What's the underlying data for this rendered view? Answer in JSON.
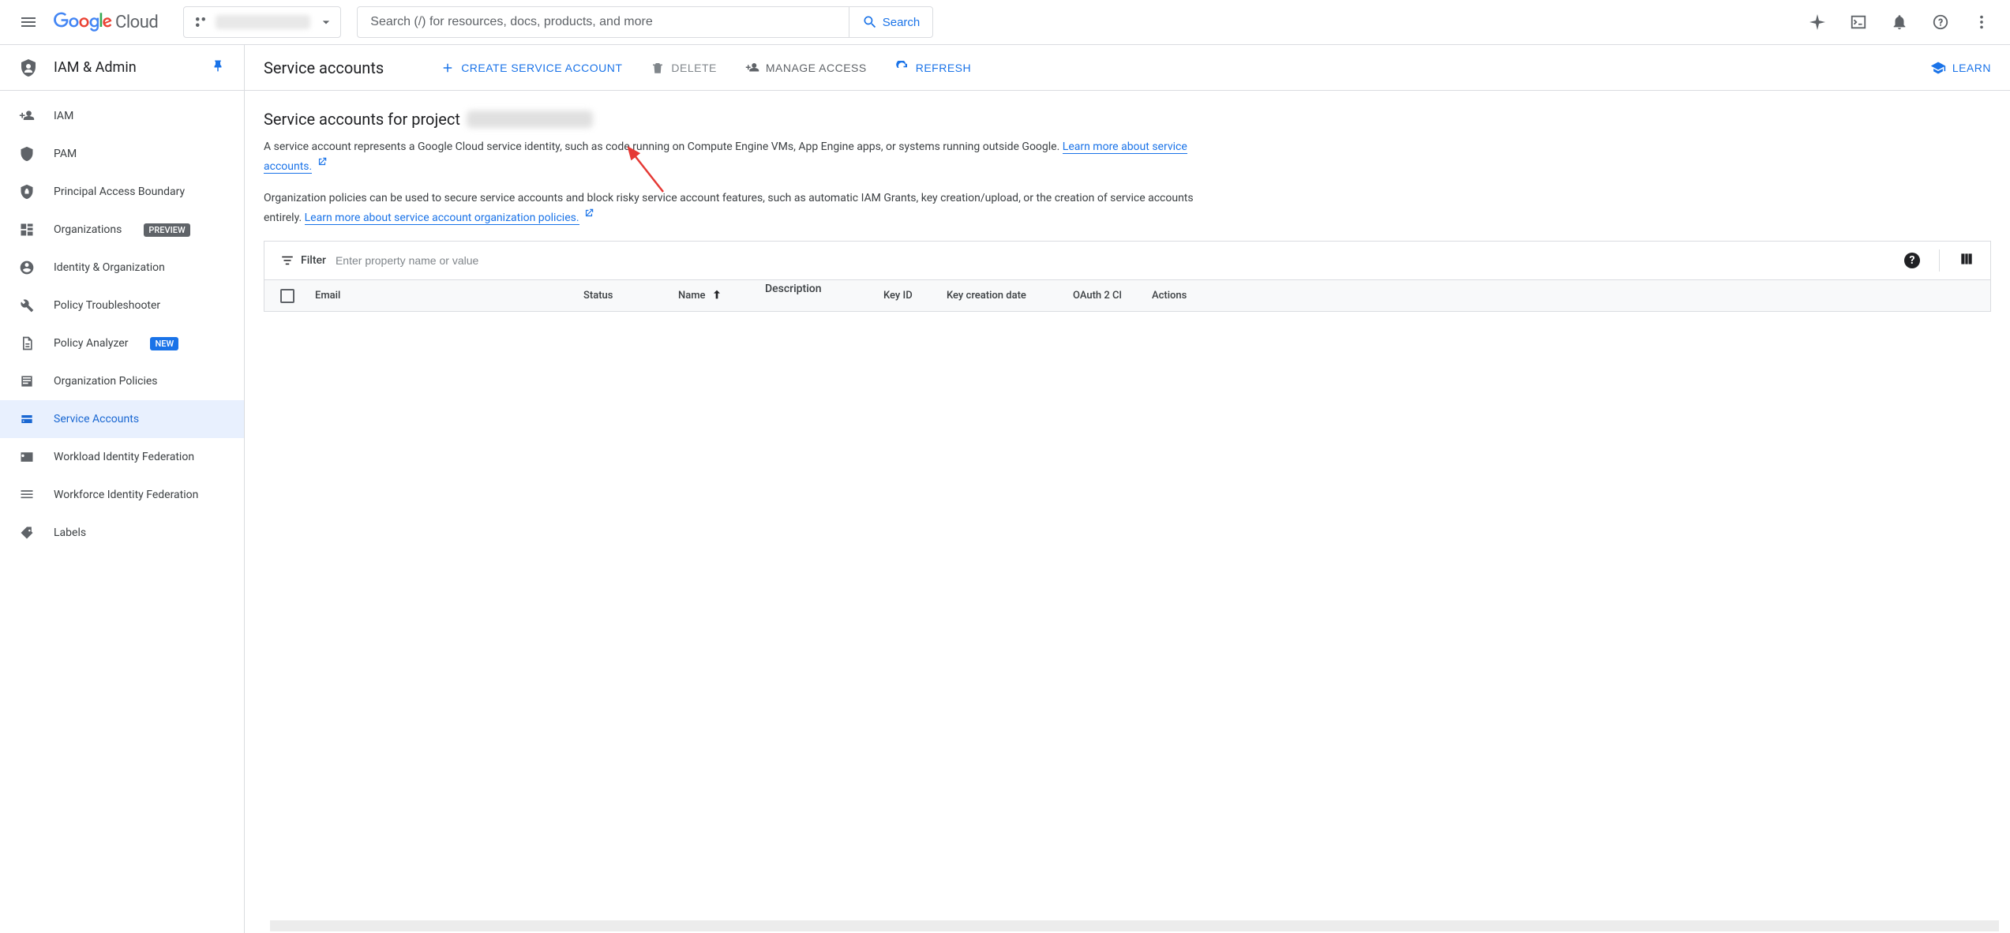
{
  "topbar": {
    "brand_product": "Cloud",
    "search_placeholder": "Search (/) for resources, docs, products, and more",
    "search_button": "Search"
  },
  "sidebar": {
    "section_title": "IAM & Admin",
    "items": [
      {
        "label": "IAM",
        "icon": "person-add"
      },
      {
        "label": "PAM",
        "icon": "shield"
      },
      {
        "label": "Principal Access Boundary",
        "icon": "shield-lock"
      },
      {
        "label": "Organizations",
        "icon": "org",
        "badge": "PREVIEW",
        "badge_kind": "preview"
      },
      {
        "label": "Identity & Organization",
        "icon": "account-circle"
      },
      {
        "label": "Policy Troubleshooter",
        "icon": "wrench"
      },
      {
        "label": "Policy Analyzer",
        "icon": "policy-doc",
        "badge": "NEW",
        "badge_kind": "new"
      },
      {
        "label": "Organization Policies",
        "icon": "article"
      },
      {
        "label": "Service Accounts",
        "icon": "service-account",
        "active": true
      },
      {
        "label": "Workload Identity Federation",
        "icon": "badge-card"
      },
      {
        "label": "Workforce Identity Federation",
        "icon": "list-lines"
      },
      {
        "label": "Labels",
        "icon": "tag"
      }
    ]
  },
  "action_bar": {
    "title": "Service accounts",
    "create": "CREATE SERVICE ACCOUNT",
    "delete": "DELETE",
    "manage_access": "MANAGE ACCESS",
    "refresh": "REFRESH",
    "learn": "LEARN"
  },
  "body": {
    "heading_prefix": "Service accounts for project",
    "para1_pre": "A service account represents a Google Cloud service identity, such as code running on Compute Engine VMs, App Engine apps, or systems running outside Google. ",
    "para1_link": "Learn more about service accounts.",
    "para2_pre": "Organization policies can be used to secure service accounts and block risky service account features, such as automatic IAM Grants, key creation/upload, or the creation of service accounts entirely. ",
    "para2_link": "Learn more about service account organization policies."
  },
  "filter": {
    "label": "Filter",
    "placeholder": "Enter property name or value"
  },
  "table": {
    "columns": [
      "Email",
      "Status",
      "Name",
      "Description",
      "Key ID",
      "Key creation date",
      "OAuth 2 Cl",
      "Actions"
    ],
    "sort_column": "Name",
    "sort_dir": "asc"
  }
}
